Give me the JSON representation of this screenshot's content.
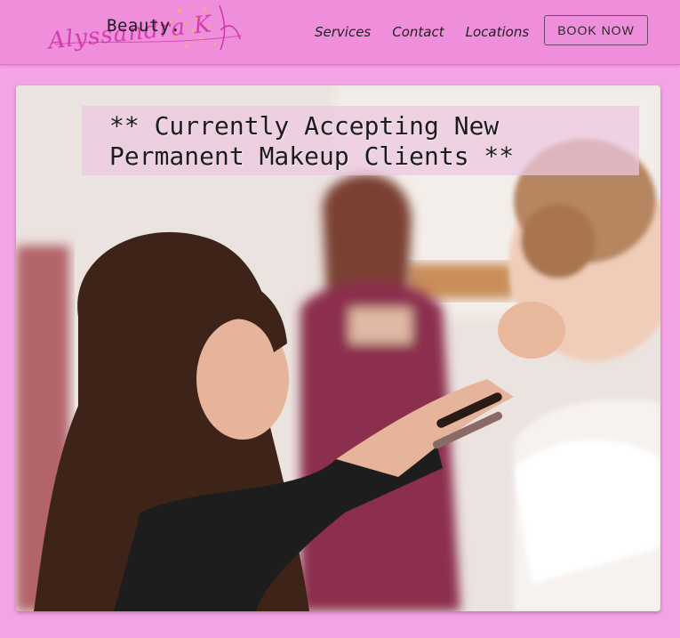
{
  "logo": {
    "brand": "Beauty.",
    "script": "Alyssandra K",
    "accent": "#d22ea6"
  },
  "nav": {
    "items": [
      {
        "label": "Services"
      },
      {
        "label": "Contact"
      },
      {
        "label": "Locations"
      }
    ]
  },
  "cta": {
    "label": "BOOK NOW"
  },
  "hero": {
    "banner": "** Currently Accepting New\nPermanent Makeup Clients **",
    "image": "makeup-artist-styling-bride-hair-photo"
  },
  "colors": {
    "page_bg": "#f4a3e6",
    "header_bg": "#ef8fdc",
    "banner_bg": "#ebc8e1"
  }
}
